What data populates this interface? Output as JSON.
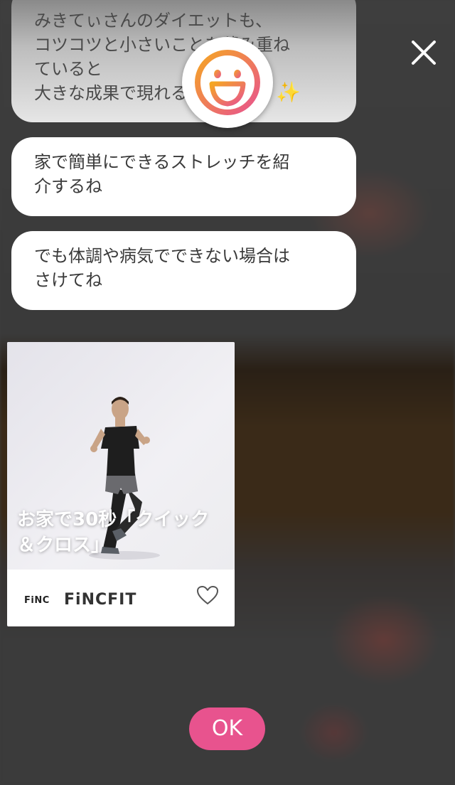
{
  "messages": [
    {
      "text": "みきてぃさんのダイエットも、\nコツコツと小さいことを積み重ね\nていると\n大きな成果で現れる"
    },
    {
      "text": "家で簡単にできるストレッチを紹\n介するね"
    },
    {
      "text": "でも体調や病気でできない場合は\nさけてね"
    }
  ],
  "card": {
    "title": "お家で30秒「クイック\n＆クロス」",
    "brand_logo": "FiNC",
    "brand_name": "FiNCFIT",
    "favorite_icon": "heart-icon"
  },
  "ok_label": "OK",
  "icons": {
    "avatar": "smiley-face-icon",
    "close": "close-icon",
    "sparkle": "sparkle-icon"
  },
  "colors": {
    "accent": "#e8538e",
    "avatar_gradient_start": "#f5a623",
    "avatar_gradient_end": "#e8538e"
  }
}
